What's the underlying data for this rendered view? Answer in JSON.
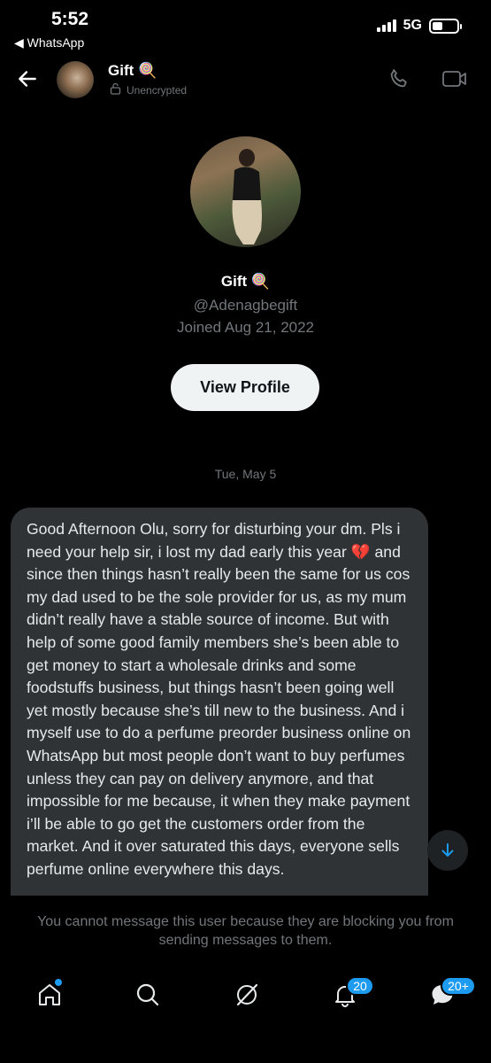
{
  "status_bar": {
    "time": "5:52",
    "back_app": "◀ WhatsApp",
    "network": "5G"
  },
  "header": {
    "name": "Gift 🍭",
    "encryption": "Unencrypted"
  },
  "profile": {
    "name": "Gift 🍭",
    "handle": "@Adenagbegift",
    "joined": "Joined Aug 21, 2022",
    "view_profile_label": "View Profile"
  },
  "conversation": {
    "date_separator": "Tue, May 5",
    "message_text": "Good Afternoon Olu, sorry for disturbing your dm. Pls i need your help sir, i lost my dad early this year 💔 and since then things hasn’t really been the same for us cos my dad used to be the sole provider for us, as my mum didn’t really have a stable source of income. But with help of some good family members she’s been able to get money to start a wholesale drinks and some foodstuffs business, but things hasn’t been going well yet mostly because she’s till new to the business. And i myself use to do a perfume preorder business online on WhatsApp but most people don’t want to buy perfumes unless they can pay on delivery anymore, and that impossible for me because, it when they make payment i’ll be able to go get the customers order from the market. And it over saturated this days, everyone sells perfume online everywhere this days."
  },
  "blocked_notice": "You cannot message this user because they are blocking you from sending messages to them.",
  "bottom_nav": {
    "notifications_badge": "20",
    "messages_badge": "20+"
  },
  "colors": {
    "background": "#000000",
    "bubble": "#2f3336",
    "muted_text": "#71767b",
    "accent": "#1d9bf0"
  }
}
